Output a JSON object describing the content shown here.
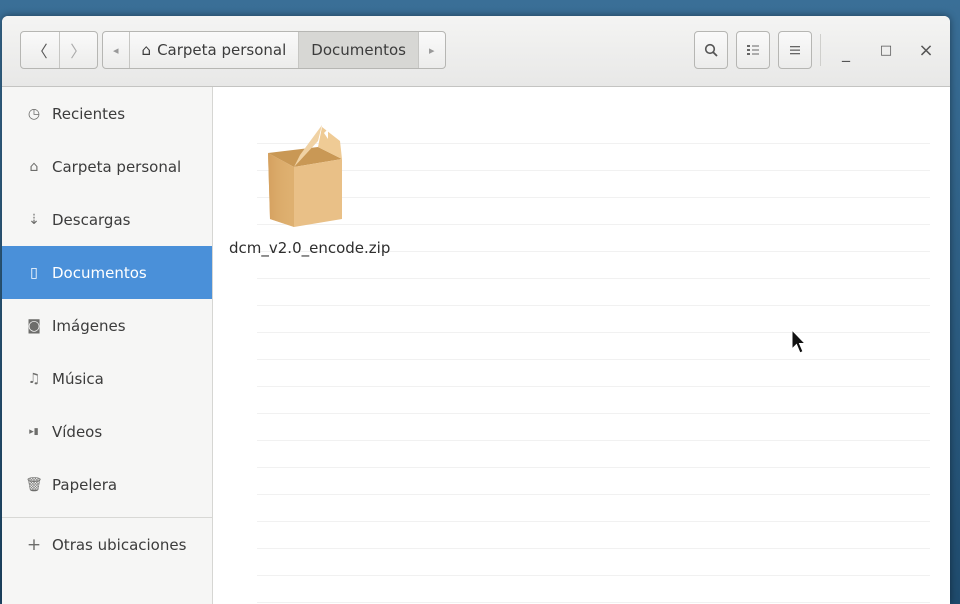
{
  "toolbar": {
    "back_icon": "chevron-left-icon",
    "forward_icon": "chevron-right-icon",
    "path_left_arrow": "◂",
    "path_right_arrow": "▸",
    "path_home": "Carpeta personal",
    "path_current": "Documentos"
  },
  "window_controls": {
    "search_icon": "search-icon",
    "view_icon": "view-options-icon",
    "menu_icon": "menu-icon",
    "minimize_glyph": "_",
    "maximize_glyph": "□",
    "close_glyph": "×"
  },
  "sidebar": {
    "items": [
      {
        "label": "Recientes",
        "icon": "clock-icon",
        "glyph": "◷"
      },
      {
        "label": "Carpeta personal",
        "icon": "home-icon",
        "glyph": "⌂"
      },
      {
        "label": "Descargas",
        "icon": "download-icon",
        "glyph": "⇣"
      },
      {
        "label": "Documentos",
        "icon": "document-icon",
        "glyph": "▯"
      },
      {
        "label": "Imágenes",
        "icon": "camera-icon",
        "glyph": "◙"
      },
      {
        "label": "Música",
        "icon": "music-icon",
        "glyph": "♫"
      },
      {
        "label": "Vídeos",
        "icon": "film-icon",
        "glyph": "▸▮"
      },
      {
        "label": "Papelera",
        "icon": "trash-icon",
        "glyph": "🗑"
      }
    ],
    "other_locations": {
      "label": "Otras ubicaciones",
      "glyph": "+"
    }
  },
  "files": [
    {
      "name": "dcm_v2.0_encode.zip",
      "icon": "archive-box-icon"
    }
  ],
  "colors": {
    "accent": "#4a90d9",
    "box": "#e4b978"
  }
}
